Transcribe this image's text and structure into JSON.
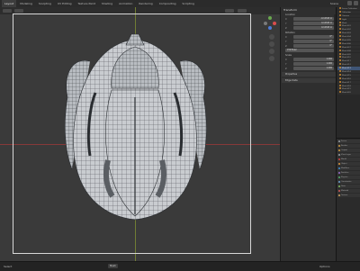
{
  "topbar": {
    "tabs": [
      "Layout",
      "Modeling",
      "Sculpting",
      "UV Editing",
      "Texture Paint",
      "Shading",
      "Animation",
      "Rendering",
      "Compositing",
      "Scripting"
    ],
    "scene_label": "Scene"
  },
  "npanel": {
    "title": "Transform",
    "location_label": "Location",
    "location": [
      {
        "axis": "X",
        "value": "-0.12345 m"
      },
      {
        "axis": "Y",
        "value": "0.12345 m"
      },
      {
        "axis": "Z",
        "value": "0.12345 m"
      }
    ],
    "rotation_label": "Rotation",
    "rotation": [
      {
        "axis": "X",
        "value": "0°"
      },
      {
        "axis": "Y",
        "value": "0°"
      },
      {
        "axis": "Z",
        "value": "0°"
      }
    ],
    "mode": "XYZ Euler",
    "scale_label": "Scale",
    "scale": [
      {
        "axis": "X",
        "value": "1.000"
      },
      {
        "axis": "Y",
        "value": "1.000"
      },
      {
        "axis": "Z",
        "value": "1.000"
      }
    ],
    "dimensions_label": "Dimensions",
    "sections": [
      "Properties",
      "Edge Data"
    ]
  },
  "outliner": {
    "rows": [
      "Scene Collection",
      "Collection",
      "Camera",
      "Light",
      "Mesh",
      "Mesh.001",
      "Mesh.002",
      "Mesh.003",
      "Mesh.004",
      "Mesh.005",
      "Mesh.006",
      "Mesh.007",
      "Mesh.008",
      "Mesh.009",
      "Mesh.010",
      "Mesh.011",
      "Mesh.012",
      "Mesh.013",
      "Mesh.014",
      "Mesh.015",
      "Mesh.016",
      "Mesh.017",
      "Mesh.018",
      "Mesh.019",
      "Mesh.020"
    ],
    "selected_index": 17
  },
  "properties": {
    "rows": [
      "Scene",
      "Render",
      "Output",
      "View Layer",
      "World",
      "Object",
      "Modifiers",
      "Particles",
      "Physics",
      "Constraints",
      "Data",
      "Material",
      "Texture"
    ],
    "colors": [
      "#9aa0a6",
      "#d39c3f",
      "#d39c3f",
      "#9aa0a6",
      "#d23c3c",
      "#e39a3c",
      "#3c8fd2",
      "#9a6fd3",
      "#4fb06a",
      "#6fa3d3",
      "#7fbf5c",
      "#d35c5c",
      "#d3a35c"
    ]
  },
  "statusbar": {
    "left": "Select",
    "center_dropdown": "Mesh",
    "right": "Options",
    "version": ""
  },
  "viewport": {
    "accent_frame_color": "#d8d8d8",
    "axis_x_color": "#9a3a3a",
    "axis_y_color": "#7f8f33"
  }
}
